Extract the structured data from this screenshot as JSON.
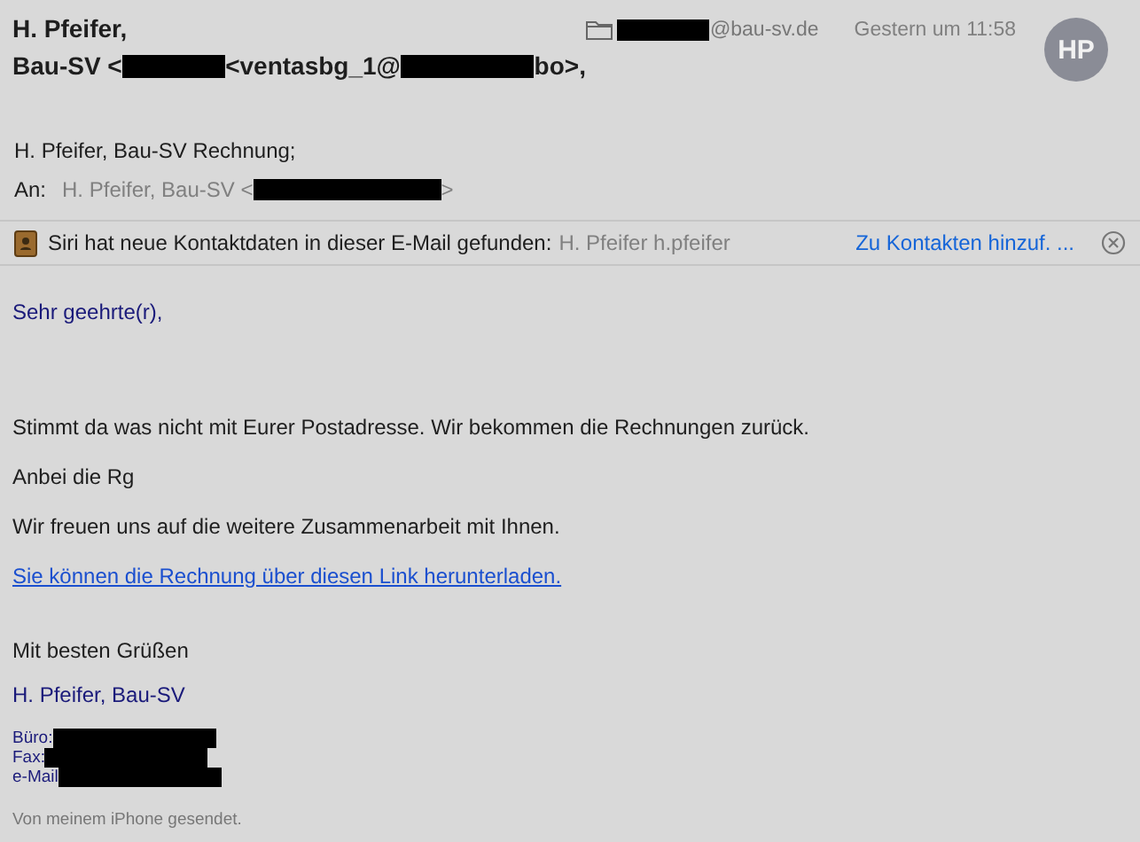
{
  "sender": {
    "line_1": "H. Pfeifer,",
    "line_2": [
      {
        "kind": "text",
        "text": "Bau-SV <"
      },
      {
        "kind": "redacted"
      },
      {
        "kind": "text",
        "text": "<ventasbg_1@"
      },
      {
        "kind": "redacted"
      },
      {
        "kind": "text",
        "text": "bo>,"
      }
    ]
  },
  "mailbox": [
    {
      "kind": "redacted"
    },
    {
      "kind": "text",
      "text": "@bau-sv.de"
    }
  ],
  "date": "Gestern um 11:58",
  "avatar": "HP",
  "subject": "H. Pfeifer, Bau-SV Rechnung;",
  "to": {
    "label": "An:",
    "value": [
      {
        "kind": "text",
        "text": "H. Pfeifer, Bau-SV <"
      },
      {
        "kind": "redacted"
      },
      {
        "kind": "text",
        "text": ">"
      }
    ]
  },
  "siri_banner": {
    "message": "Siri hat neue Kontaktdaten in dieser E-Mail gefunden:",
    "contact": "H. Pfeifer h.pfeifer",
    "action": "Zu Kontakten hinzuf. ..."
  },
  "body": [
    {
      "kind": "greeting",
      "text": "Sehr geehrte(r),"
    },
    {
      "kind": "paragraph",
      "text": "Stimmt da was nicht mit Eurer Postadresse. Wir bekommen die Rechnungen zurück."
    },
    {
      "kind": "paragraph",
      "text": "Anbei die Rg"
    },
    {
      "kind": "paragraph",
      "text": "Wir freuen uns auf die weitere Zusammenarbeit mit Ihnen."
    },
    {
      "kind": "link",
      "text": "Sie können die Rechnung über diesen Link herunterladen."
    },
    {
      "kind": "closing",
      "text": "Mit besten Grüßen"
    },
    {
      "kind": "signature",
      "text": "H. Pfeifer, Bau-SV"
    },
    {
      "kind": "contact",
      "parts": [
        {
          "kind": "text",
          "text": "Büro:"
        },
        {
          "kind": "redacted"
        }
      ]
    },
    {
      "kind": "contact",
      "parts": [
        {
          "kind": "text",
          "text": "Fax:"
        },
        {
          "kind": "redacted"
        }
      ]
    },
    {
      "kind": "contact",
      "parts": [
        {
          "kind": "text",
          "text": "e-Mail"
        },
        {
          "kind": "redacted"
        }
      ]
    },
    {
      "kind": "footer",
      "text": "Von meinem iPhone gesendet."
    }
  ]
}
